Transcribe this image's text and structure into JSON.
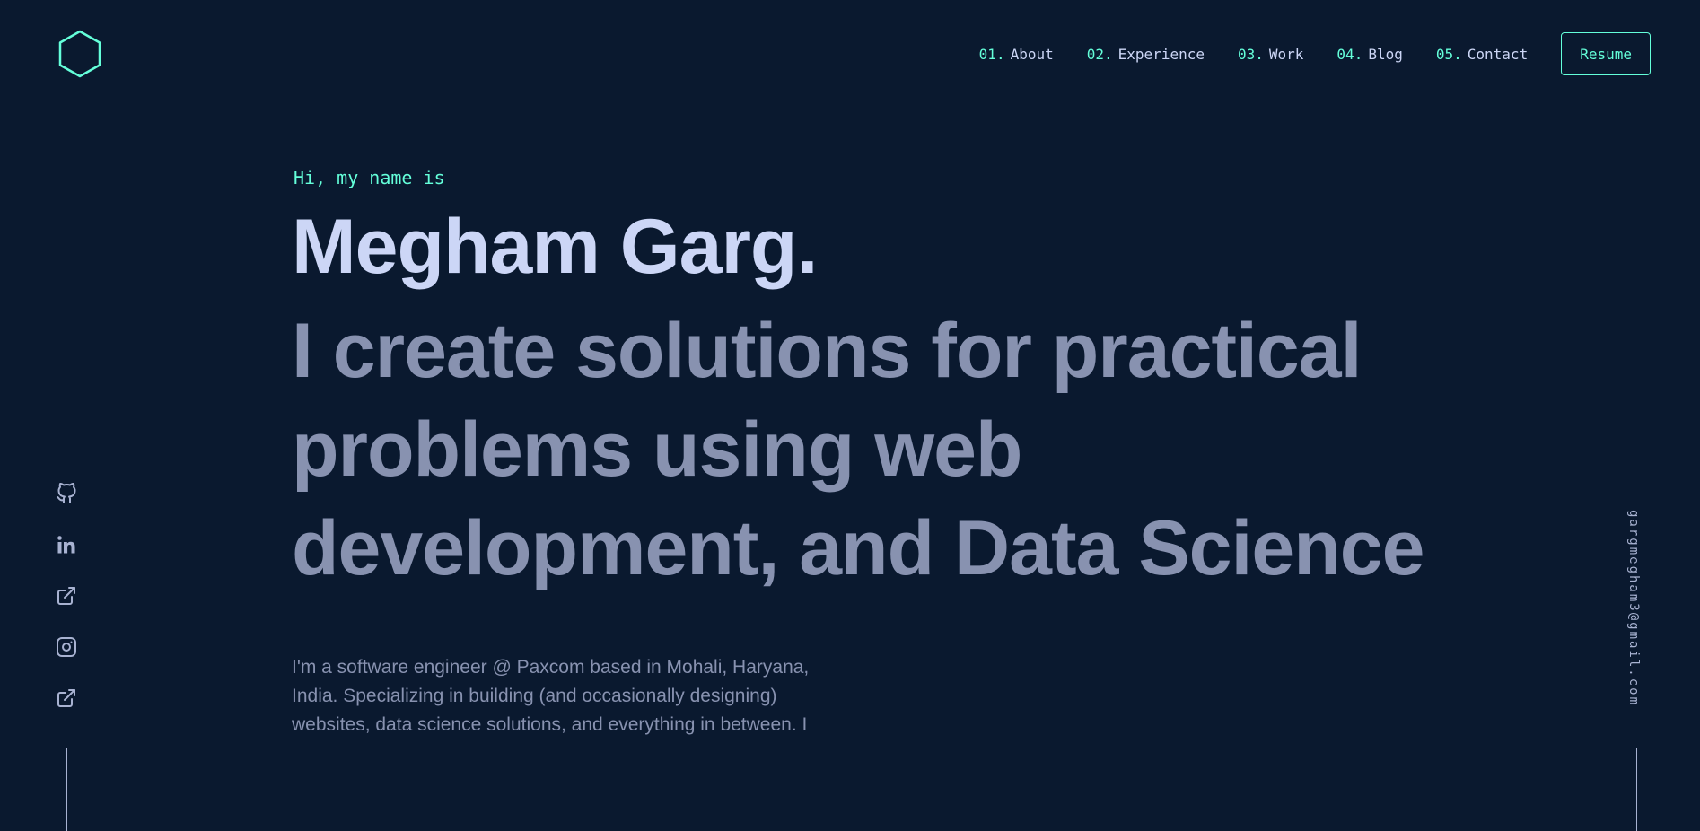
{
  "nav": {
    "items": [
      {
        "num": "01.",
        "label": "About"
      },
      {
        "num": "02.",
        "label": "Experience"
      },
      {
        "num": "03.",
        "label": "Work"
      },
      {
        "num": "04.",
        "label": "Blog"
      },
      {
        "num": "05.",
        "label": "Contact"
      }
    ],
    "resume_label": "Resume"
  },
  "hero": {
    "greeting": "Hi, my name is",
    "name": "Megham Garg.",
    "tagline": "I create solutions for practical problems using web development, and Data Science",
    "bio": "I'm a software engineer @ Paxcom based in Mohali, Haryana, India. Specializing in building (and occasionally designing) websites, data science solutions, and everything in between. I"
  },
  "socials": [
    {
      "icon": "github-icon"
    },
    {
      "icon": "linkedin-icon"
    },
    {
      "icon": "external-link-icon"
    },
    {
      "icon": "instagram-icon"
    },
    {
      "icon": "external-link-icon"
    }
  ],
  "email": "gargmegham3@gmail.com",
  "colors": {
    "background": "#0a192f",
    "accent": "#64ffda",
    "heading": "#ccd6f6",
    "body_text": "#8892b0"
  }
}
